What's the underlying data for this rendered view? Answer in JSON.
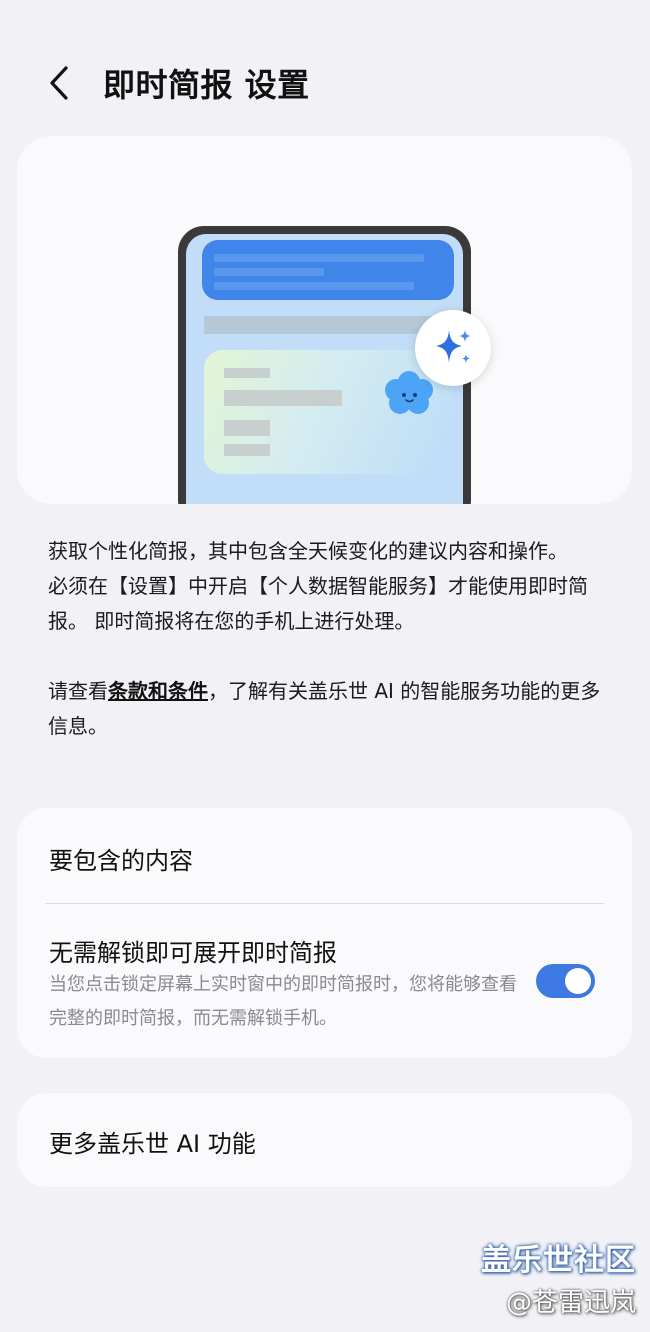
{
  "header": {
    "title": "即时简报 设置"
  },
  "hero": {
    "illustration": "phone-now-brief-illustration",
    "badge_icon": "sparkle-icon",
    "mascot_icon": "cloud-mascot-icon",
    "colors": {
      "notification": "#3f85ea",
      "screen": "#c2ddf7",
      "sparkle": "#2f6fe0"
    }
  },
  "description": {
    "line1": "获取个性化简报，其中包含全天候变化的建议内容和操作。",
    "line2": "必须在【设置】中开启【个人数据智能服务】才能使用即时简报。 即时简报将在您的手机上进行处理。",
    "terms_prefix": "请查看",
    "terms_link": "条款和条件",
    "terms_suffix": "，了解有关盖乐世 AI 的智能服务功能的更多信息。"
  },
  "settings": {
    "content_to_include": "要包含的内容",
    "unlock_title": "无需解锁即可展开即时简报",
    "unlock_desc": "当您点击锁定屏幕上实时窗中的即时简报时，您将能够查看完整的即时简报，而无需解锁手机。",
    "unlock_enabled": true,
    "accent_color": "#3e78e3"
  },
  "more": {
    "label": "更多盖乐世 AI 功能"
  },
  "watermark": {
    "line1": "盖乐世社区",
    "line2": "@苍雷迅岚"
  }
}
